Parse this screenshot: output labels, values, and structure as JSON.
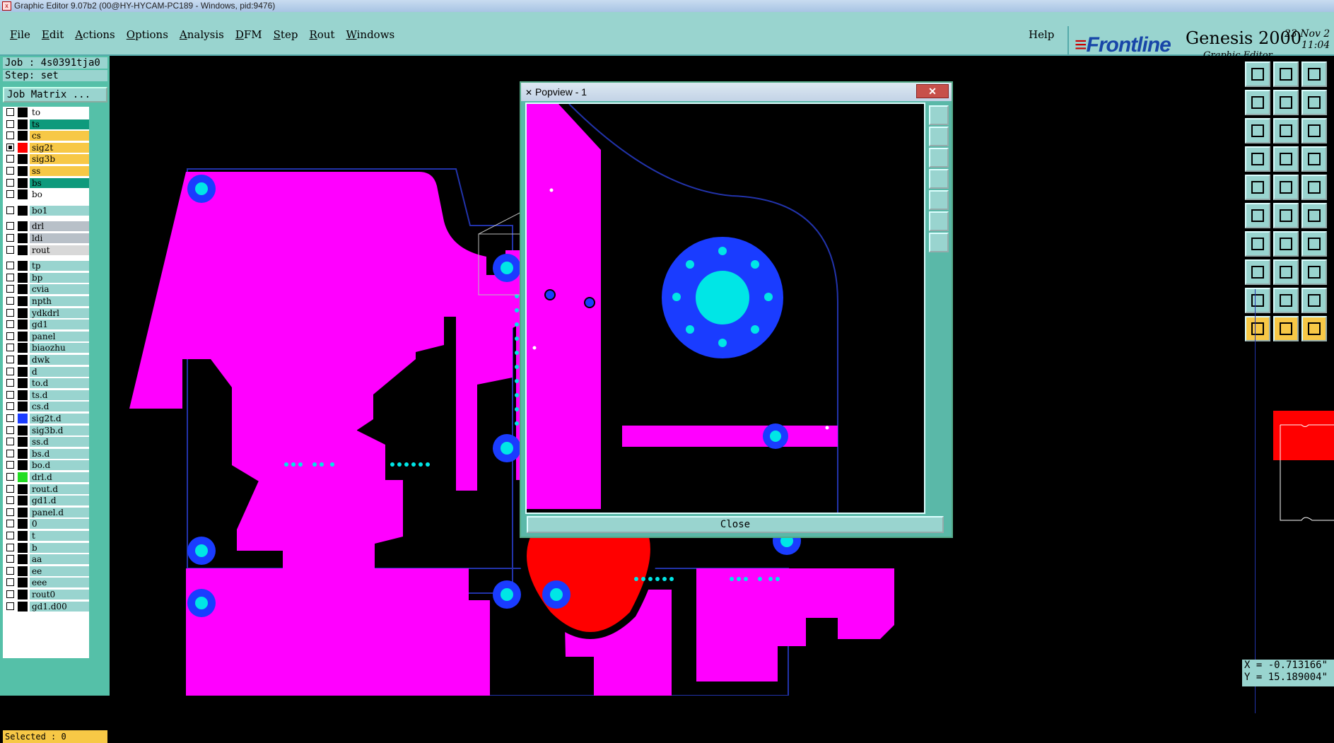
{
  "window": {
    "title": "Graphic Editor 9.07b2 (00@HY-HYCAM-PC189 - Windows, pid:9476)"
  },
  "menu": {
    "items": [
      "File",
      "Edit",
      "Actions",
      "Options",
      "Analysis",
      "DFM",
      "Step",
      "Rout",
      "Windows"
    ],
    "help": "Help"
  },
  "brand": {
    "logo": "Frontline",
    "product": "Genesis 2000",
    "subtitle": "Graphic Editor",
    "date": "23 Nov 2",
    "time": "11:04 "
  },
  "job": {
    "job_line": "Job : 4s0391tja0",
    "step_line": "Step: set",
    "matrix_button": "Job Matrix ..."
  },
  "layers": [
    {
      "name": "to",
      "color": "#ffffff",
      "swatch": "",
      "checked": false
    },
    {
      "name": "ts",
      "color": "#0e9a7c",
      "swatch": "",
      "checked": false
    },
    {
      "name": "cs",
      "color": "#f7c846",
      "swatch": "",
      "checked": false
    },
    {
      "name": "sig2t",
      "color": "#f7c846",
      "swatch": "#ff0000",
      "checked": true
    },
    {
      "name": "sig3b",
      "color": "#f7c846",
      "swatch": "",
      "checked": false
    },
    {
      "name": "ss",
      "color": "#f7c846",
      "swatch": "",
      "checked": false
    },
    {
      "name": "bs",
      "color": "#0e9a7c",
      "swatch": "",
      "checked": false
    },
    {
      "name": "bo",
      "color": "#ffffff",
      "swatch": "",
      "checked": false
    },
    {
      "name": "bo1",
      "color": "#99d4cf",
      "swatch": "",
      "checked": false
    },
    {
      "name": "drl",
      "color": "#b8c0c8",
      "swatch": "",
      "checked": false
    },
    {
      "name": "ldi",
      "color": "#b8c0c8",
      "swatch": "",
      "checked": false
    },
    {
      "name": "rout",
      "color": "#d8d8d8",
      "swatch": "",
      "checked": false
    },
    {
      "name": "tp",
      "color": "#99d4cf",
      "swatch": "",
      "checked": false
    },
    {
      "name": "bp",
      "color": "#99d4cf",
      "swatch": "",
      "checked": false
    },
    {
      "name": "cvia",
      "color": "#99d4cf",
      "swatch": "",
      "checked": false
    },
    {
      "name": "npth",
      "color": "#99d4cf",
      "swatch": "",
      "checked": false
    },
    {
      "name": "ydkdrl",
      "color": "#99d4cf",
      "swatch": "",
      "checked": false
    },
    {
      "name": "gd1",
      "color": "#99d4cf",
      "swatch": "",
      "checked": false
    },
    {
      "name": "panel",
      "color": "#99d4cf",
      "swatch": "",
      "checked": false
    },
    {
      "name": "biaozhu",
      "color": "#99d4cf",
      "swatch": "",
      "checked": false
    },
    {
      "name": "dwk",
      "color": "#99d4cf",
      "swatch": "",
      "checked": false
    },
    {
      "name": "d",
      "color": "#99d4cf",
      "swatch": "",
      "checked": false
    },
    {
      "name": "to.d",
      "color": "#99d4cf",
      "swatch": "",
      "checked": false
    },
    {
      "name": "ts.d",
      "color": "#99d4cf",
      "swatch": "",
      "checked": false
    },
    {
      "name": "cs.d",
      "color": "#99d4cf",
      "swatch": "",
      "checked": false
    },
    {
      "name": "sig2t.d",
      "color": "#99d4cf",
      "swatch": "#1a3cff",
      "checked": false
    },
    {
      "name": "sig3b.d",
      "color": "#99d4cf",
      "swatch": "",
      "checked": false
    },
    {
      "name": "ss.d",
      "color": "#99d4cf",
      "swatch": "",
      "checked": false
    },
    {
      "name": "bs.d",
      "color": "#99d4cf",
      "swatch": "",
      "checked": false
    },
    {
      "name": "bo.d",
      "color": "#99d4cf",
      "swatch": "",
      "checked": false
    },
    {
      "name": "drl.d",
      "color": "#99d4cf",
      "swatch": "#22dd22",
      "checked": false
    },
    {
      "name": "rout.d",
      "color": "#99d4cf",
      "swatch": "",
      "checked": false
    },
    {
      "name": "gd1.d",
      "color": "#99d4cf",
      "swatch": "",
      "checked": false
    },
    {
      "name": "panel.d",
      "color": "#99d4cf",
      "swatch": "",
      "checked": false
    },
    {
      "name": "0",
      "color": "#99d4cf",
      "swatch": "",
      "checked": false
    },
    {
      "name": "t",
      "color": "#99d4cf",
      "swatch": "",
      "checked": false
    },
    {
      "name": "b",
      "color": "#99d4cf",
      "swatch": "",
      "checked": false
    },
    {
      "name": "aa",
      "color": "#99d4cf",
      "swatch": "",
      "checked": false
    },
    {
      "name": "ee",
      "color": "#99d4cf",
      "swatch": "",
      "checked": false
    },
    {
      "name": "eee",
      "color": "#99d4cf",
      "swatch": "",
      "checked": false
    },
    {
      "name": "rout0",
      "color": "#99d4cf",
      "swatch": "",
      "checked": false
    },
    {
      "name": "gd1.d00",
      "color": "#99d4cf",
      "swatch": "",
      "checked": false
    }
  ],
  "status": {
    "selected": "Selected : 0"
  },
  "coords": {
    "x": "X = -0.713166\"",
    "y": "Y = 15.189004\""
  },
  "popview": {
    "title": "Popview - 1",
    "close_label": "Close",
    "close_x": "✕"
  },
  "colors": {
    "copper": "#ff00ff",
    "pad": "#1a3cff",
    "hole": "#00e6e6",
    "red": "#ff0000",
    "panel_bg": "#99d4cf"
  }
}
